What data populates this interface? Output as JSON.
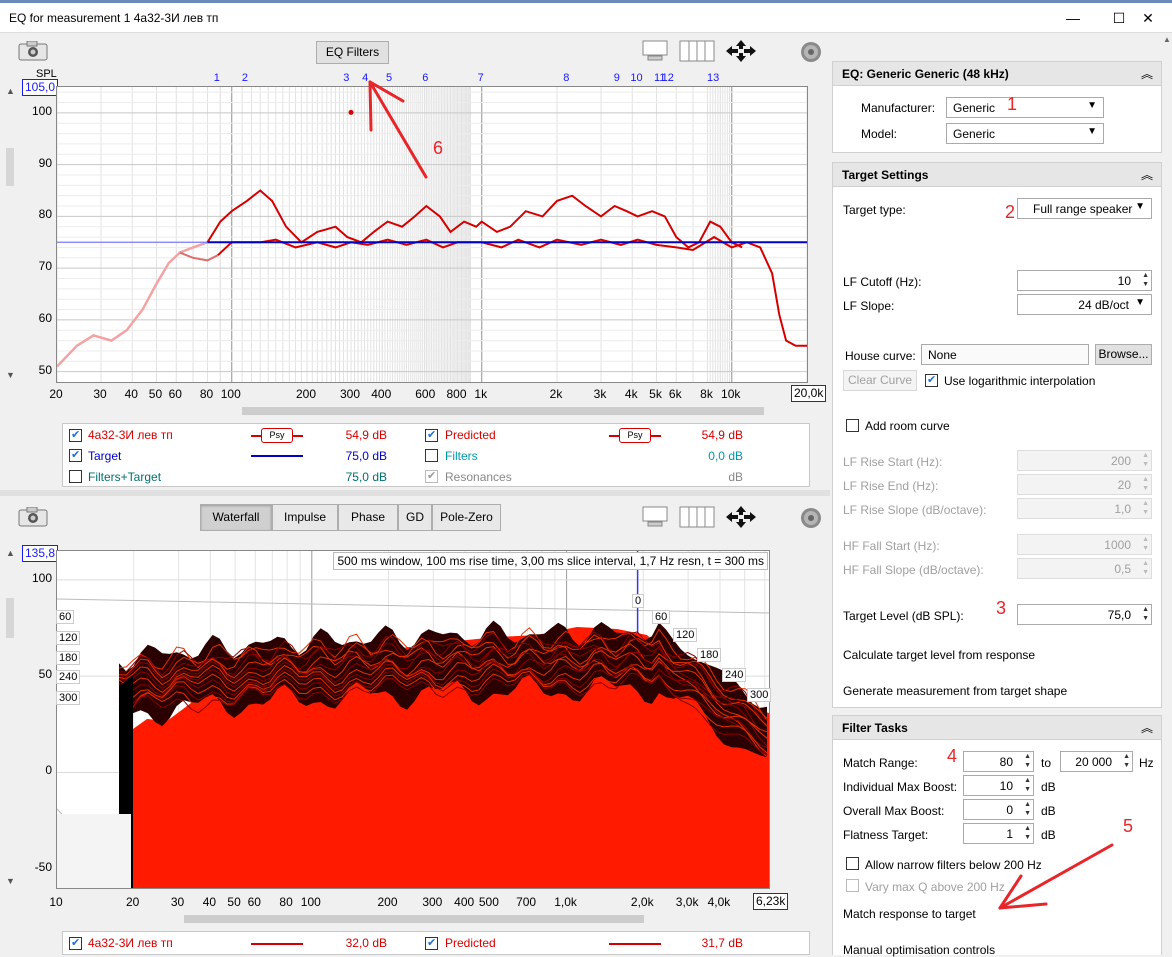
{
  "window": {
    "title": "EQ for measurement 1 4a32-3И лев тп",
    "minimize": "—",
    "maximize": "☐",
    "close": "✕"
  },
  "top_graph": {
    "toolbar_button": "EQ Filters",
    "y_axis_title": "SPL",
    "y_top_box": "105,0",
    "y_ticks": [
      "100",
      "90",
      "80",
      "70",
      "60",
      "50"
    ],
    "x_ticks": [
      "20",
      "30",
      "40",
      "50",
      "60",
      "80",
      "100",
      "200",
      "300",
      "400",
      "600",
      "800",
      "1k",
      "2k",
      "3k",
      "4k",
      "5k",
      "6k",
      "8k",
      "10k"
    ],
    "x_end_box": "20,0k",
    "filter_markers": [
      "1",
      "2",
      "3",
      "4",
      "5",
      "6",
      "7",
      "8",
      "9",
      "10",
      "11",
      "12",
      "13"
    ],
    "legend": {
      "rows": [
        {
          "label": "4a32-3И лев тп",
          "checked": true,
          "psy": "Psy",
          "value": "54,9 dB",
          "color": "#d40000"
        },
        {
          "label": "Target",
          "checked": true,
          "value": "75,0 dB",
          "color": "#0000c8"
        },
        {
          "label": "Filters+Target",
          "checked": false,
          "value": "75,0 dB",
          "color": "#007070"
        },
        {
          "label": "Predicted",
          "checked": true,
          "psy": "Psy",
          "value": "54,9 dB",
          "color": "#d40000"
        },
        {
          "label": "Filters",
          "checked": false,
          "value": "0,0 dB",
          "color": "#0099aa"
        },
        {
          "label": "Resonances",
          "checked": true,
          "disabled": true,
          "value": "dB",
          "color": "#888888"
        }
      ]
    }
  },
  "bottom_graph": {
    "tabs": [
      "Waterfall",
      "Impulse",
      "Phase",
      "GD",
      "Pole-Zero"
    ],
    "active_tab": "Waterfall",
    "y_top_box": "135,8",
    "y_ticks": [
      "100",
      "50",
      "0",
      "-50"
    ],
    "info": "500 ms window, 100 ms rise time, 3,00 ms slice interval, 1,7 Hz resn, t = 300 ms",
    "time_labels_left": [
      "60",
      "120",
      "180",
      "240",
      "300"
    ],
    "time_labels_right": [
      "0",
      "60",
      "120",
      "180",
      "240",
      "300"
    ],
    "x_ticks": [
      "10",
      "20",
      "30",
      "40",
      "50",
      "60",
      "80",
      "100",
      "200",
      "300",
      "400",
      "500",
      "700",
      "1,0k",
      "2,0k",
      "3,0k",
      "4,0k",
      "6,"
    ],
    "x_end_box": "6,23k",
    "legend": {
      "row1_label": "4a32-3И лев тп",
      "row1_value": "32,0 dB",
      "row2_label": "Predicted",
      "row2_value": "31,7 dB"
    }
  },
  "right_panel": {
    "eq_header": "EQ: Generic Generic (48 kHz)",
    "manufacturer_label": "Manufacturer:",
    "manufacturer_value": "Generic",
    "model_label": "Model:",
    "model_value": "Generic",
    "target_header": "Target Settings",
    "target_type_label": "Target type:",
    "target_type_value": "Full range speaker",
    "lf_cutoff_label": "LF Cutoff (Hz):",
    "lf_cutoff_value": "10",
    "lf_slope_label": "LF Slope:",
    "lf_slope_value": "24 dB/oct",
    "house_curve_label": "House curve:",
    "house_curve_value": "None",
    "browse_button": "Browse...",
    "clear_curve_button": "Clear Curve",
    "log_interp_label": "Use logarithmic interpolation",
    "add_room_curve_label": "Add room curve",
    "lf_rise_start_label": "LF Rise Start (Hz):",
    "lf_rise_start_value": "200",
    "lf_rise_end_label": "LF Rise End (Hz):",
    "lf_rise_end_value": "20",
    "lf_rise_slope_label": "LF Rise Slope (dB/octave):",
    "lf_rise_slope_value": "1,0",
    "hf_fall_start_label": "HF Fall Start (Hz):",
    "hf_fall_start_value": "1000",
    "hf_fall_slope_label": "HF Fall Slope (dB/octave):",
    "hf_fall_slope_value": "0,5",
    "target_level_label": "Target Level (dB SPL):",
    "target_level_value": "75,0",
    "calc_target_label": "Calculate target level from response",
    "generate_meas_label": "Generate measurement from target shape",
    "filter_tasks_header": "Filter Tasks",
    "match_range_label": "Match Range:",
    "match_range_from": "80",
    "match_range_to_label": "to",
    "match_range_to": "20 000",
    "hz_label": "Hz",
    "ind_max_boost_label": "Individual Max Boost:",
    "ind_max_boost_value": "10",
    "overall_max_boost_label": "Overall Max Boost:",
    "overall_max_boost_value": "0",
    "flatness_label": "Flatness Target:",
    "flatness_value": "1",
    "db_unit": "dB",
    "narrow_filters_label": "Allow narrow filters below 200 Hz",
    "vary_q_label": "Vary max Q above 200 Hz",
    "match_response_label": "Match response to target",
    "manual_opt_label": "Manual optimisation controls"
  },
  "annotations": [
    "1",
    "2",
    "3",
    "4",
    "5",
    "6"
  ],
  "colors": {
    "measurement": "#d40000",
    "target": "#0000c8",
    "annotation": "#e8262a",
    "box_label": "#1a1aff"
  },
  "icons": [
    "camera-icon",
    "gear-icon",
    "layout-icon",
    "columns-icon",
    "move-arrows-icon",
    "chevron-up-icon",
    "dropdown-arrow-icon"
  ]
}
